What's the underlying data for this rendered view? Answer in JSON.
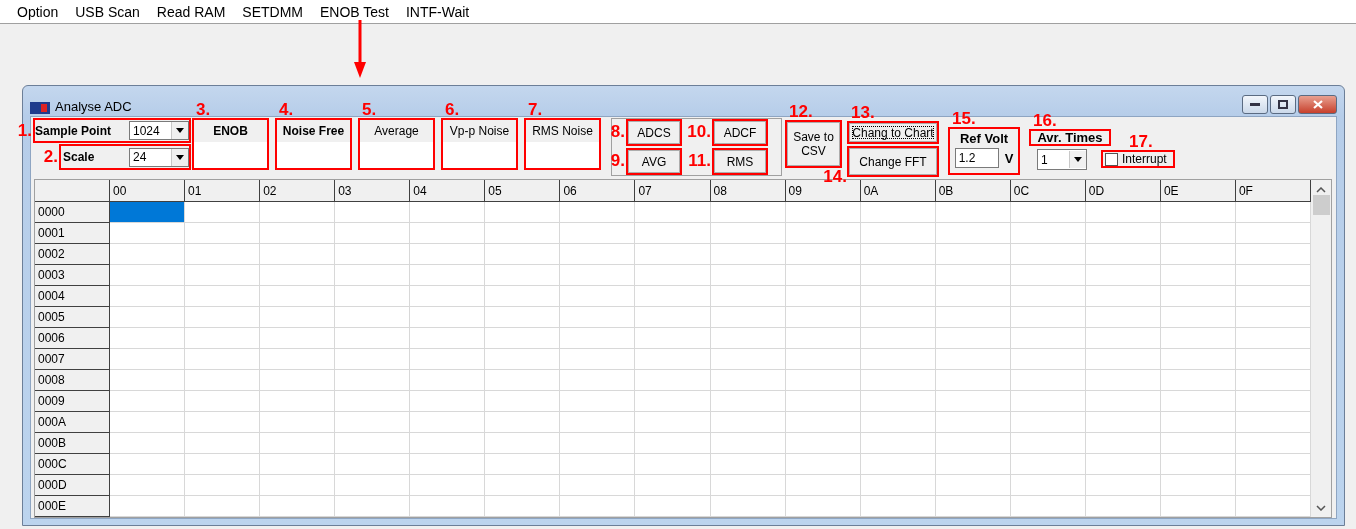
{
  "menu": [
    "Option",
    "USB Scan",
    "Read RAM",
    "SETDMM",
    "ENOB Test",
    "INTF-Wait"
  ],
  "window": {
    "title": "Analyse ADC"
  },
  "controls": {
    "sample_point": {
      "annotation": "1.",
      "label": "Sample Point",
      "value": "1024"
    },
    "scale": {
      "annotation": "2.",
      "label": "Scale",
      "value": "24"
    },
    "readouts": [
      {
        "annotation": "3.",
        "label": "ENOB",
        "bold": true
      },
      {
        "annotation": "4.",
        "label": "Noise Free",
        "bold": true
      },
      {
        "annotation": "5.",
        "label": "Average",
        "bold": false
      },
      {
        "annotation": "6.",
        "label": "Vp-p Noise",
        "bold": false
      },
      {
        "annotation": "7.",
        "label": "RMS Noise",
        "bold": false
      }
    ],
    "buttons": [
      {
        "annotation": "8.",
        "label": "ADCS"
      },
      {
        "annotation": "9.",
        "label": "AVG"
      },
      {
        "annotation": "10.",
        "label": "ADCF"
      },
      {
        "annotation": "11.",
        "label": "RMS"
      }
    ],
    "save": {
      "annotation": "12.",
      "lines": [
        "Save to",
        "CSV"
      ]
    },
    "chart_button": {
      "annotation": "13.",
      "label": "Chang to Chart",
      "focused": true
    },
    "fft_button": {
      "annotation": "14.",
      "label": "Change FFT",
      "focused": false
    },
    "ref_volt": {
      "annotation": "15.",
      "label": "Ref Volt",
      "value": "1.2",
      "unit": "V"
    },
    "avr_times": {
      "annotation": "16.",
      "label": "Avr. Times",
      "value": "1"
    },
    "interrupt": {
      "annotation": "17.",
      "label": "Interrupt",
      "checked": false
    }
  },
  "grid": {
    "columns": [
      {
        "label": "00",
        "selected": true
      },
      {
        "label": "01",
        "selected": false
      },
      {
        "label": "02",
        "selected": false
      },
      {
        "label": "03",
        "selected": false
      },
      {
        "label": "04",
        "selected": false
      },
      {
        "label": "05",
        "selected": false
      },
      {
        "label": "06",
        "selected": false
      },
      {
        "label": "07",
        "selected": false
      },
      {
        "label": "08",
        "selected": false
      },
      {
        "label": "09",
        "selected": false
      },
      {
        "label": "0A",
        "selected": false
      },
      {
        "label": "0B",
        "selected": false
      },
      {
        "label": "0C",
        "selected": false
      },
      {
        "label": "0D",
        "selected": false
      },
      {
        "label": "0E",
        "selected": false
      },
      {
        "label": "0F",
        "selected": false
      }
    ],
    "rows": [
      {
        "label": "0000",
        "selected": true
      },
      {
        "label": "0001",
        "selected": false
      },
      {
        "label": "0002",
        "selected": false
      },
      {
        "label": "0003",
        "selected": false
      },
      {
        "label": "0004",
        "selected": false
      },
      {
        "label": "0005",
        "selected": false
      },
      {
        "label": "0006",
        "selected": false
      },
      {
        "label": "0007",
        "selected": false
      },
      {
        "label": "0008",
        "selected": false
      },
      {
        "label": "0009",
        "selected": false
      },
      {
        "label": "000A",
        "selected": false
      },
      {
        "label": "000B",
        "selected": false
      },
      {
        "label": "000C",
        "selected": false
      },
      {
        "label": "000D",
        "selected": false
      },
      {
        "label": "000E",
        "selected": false
      }
    ]
  }
}
